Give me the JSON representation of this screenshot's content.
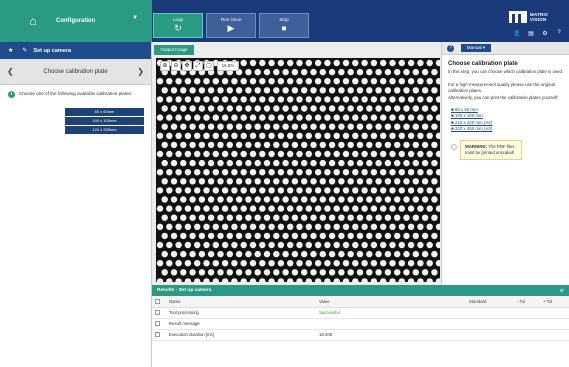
{
  "topbar": {
    "config_label": "Configuration",
    "buttons": [
      {
        "label": "Loop",
        "icon": "↻"
      },
      {
        "label": "Run Once",
        "icon": "▶"
      },
      {
        "label": "Stop",
        "icon": "⏹"
      }
    ],
    "logo_line1": "MATRIX",
    "logo_line2": "VISION",
    "icons": [
      "👤",
      "▤",
      "⚙",
      "?"
    ]
  },
  "left": {
    "header_title": "Set up camera",
    "step_title": "Choose calibration plate",
    "info_text": "Choose one of the following available calibration plates:",
    "plates": [
      "60 x 60mm",
      "100 x 100mm",
      "120 x 250mm"
    ]
  },
  "center": {
    "output_tab": "Output Image",
    "zoom": "16.8%"
  },
  "help": {
    "manual_label": "Manual",
    "title": "Choose calibration plate",
    "p1": "In this step, you can choose which calibration plate is used.",
    "p2": "For a high measurement quality please use the original calibration plates.",
    "p3": "Alternatively, you can print the calibration plates yourself:",
    "links": [
      "60 x 60 mm",
      "100 x 100 mm",
      "210 x 240 mm (A4)",
      "320 x 450 mm (A3)"
    ],
    "warning_bold": "WARNING:",
    "warning_text": " The PDF files must be printed unscaled!"
  },
  "results": {
    "title": "Results - Set up camera",
    "columns": [
      "",
      "Name",
      "Value",
      "Standard",
      "- Tol",
      "+ Tol"
    ],
    "rows": [
      {
        "name": "Tool processing",
        "value": "Successful",
        "ok": true
      },
      {
        "name": "Result message",
        "value": "",
        "ok": false
      },
      {
        "name": "Execution duration [ms]",
        "value": "18.406",
        "ok": false
      }
    ]
  },
  "colors": {
    "navy": "#1a3a7a",
    "teal": "#2a9a84",
    "panel_blue": "#1f4d8c"
  }
}
